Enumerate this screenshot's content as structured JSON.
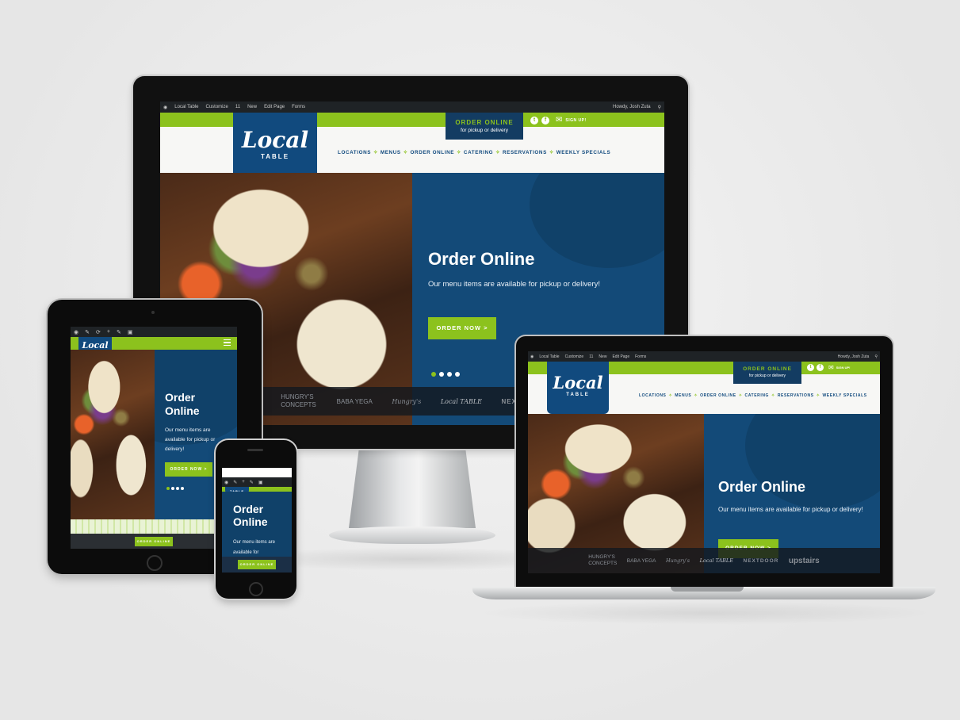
{
  "colors": {
    "green": "#8cc21d",
    "navy": "#114a7e",
    "hero_blue": "#134a78",
    "wp_bar": "#1f2326"
  },
  "wpbar": {
    "site_name": "Local Table",
    "customize": "Customize",
    "updates": "11",
    "new": "New",
    "edit_page": "Edit Page",
    "forms": "Forms",
    "howdy": "Howdy, Josh Zuta"
  },
  "header": {
    "logo_main": "Local",
    "logo_sub": "TABLE",
    "order_title": "ORDER ONLINE",
    "order_sub": "for pickup or delivery",
    "twitter_icon": "t",
    "facebook_icon": "f",
    "signup": "SIGN UP!"
  },
  "nav": [
    "LOCATIONS",
    "MENUS",
    "ORDER ONLINE",
    "CATERING",
    "RESERVATIONS",
    "WEEKLY SPECIALS"
  ],
  "hero": {
    "title": "Order Online",
    "text": "Our menu items are available for pickup or delivery!",
    "button": "ORDER NOW >",
    "slides": 4,
    "active_slide": 1
  },
  "tablet_hero": {
    "title_line1": "Order",
    "title_line2": "Online",
    "text": "Our menu items are available for pickup or delivery!",
    "button": "ORDER NOW >"
  },
  "phone_hero": {
    "title_line1": "Order",
    "title_line2": "Online",
    "text": "Our menu items are available for"
  },
  "brands": {
    "hungrys": "HUNGRY'S CONCEPTS",
    "babayega": "BABA YEGA",
    "hungrys_script": "Hungry's",
    "localtable": "Local TABLE",
    "nextdoor": "NEXTDOOR",
    "upstairs": "upstairs"
  },
  "sticky_order": "ORDER ONLINE",
  "phone_order": "ORDER ONLINE"
}
